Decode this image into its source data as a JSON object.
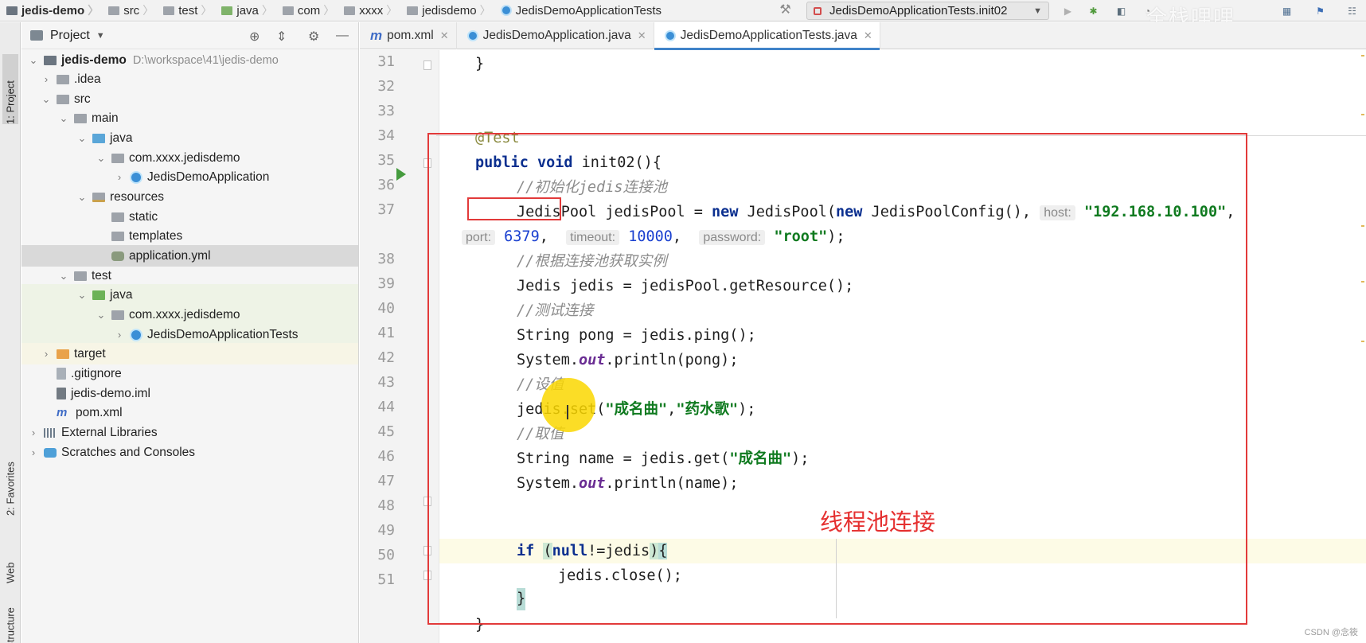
{
  "breadcrumbs": [
    {
      "label": "jedis-demo",
      "icon": "module-icon"
    },
    {
      "label": "src",
      "icon": "folder-icon"
    },
    {
      "label": "test",
      "icon": "folder-icon"
    },
    {
      "label": "java",
      "icon": "test-folder-icon"
    },
    {
      "label": "com",
      "icon": "folder-icon"
    },
    {
      "label": "xxxx",
      "icon": "folder-icon"
    },
    {
      "label": "jedisdemo",
      "icon": "folder-icon"
    },
    {
      "label": "JedisDemoApplicationTests",
      "icon": "class-icon"
    }
  ],
  "toolbar": {
    "run_config": "JedisDemoApplicationTests.init02",
    "watermark": "全栈哩哩"
  },
  "left_strip": {
    "project_tab": "1: Project",
    "favorites_tab": "2: Favorites",
    "web_tab": "Web",
    "structure_tab": "Z: Structure"
  },
  "project_panel": {
    "title": "Project",
    "tree": [
      {
        "label": "jedis-demo",
        "path": "D:\\workspace\\41\\jedis-demo"
      },
      {
        "label": ".idea"
      },
      {
        "label": "src"
      },
      {
        "label": "main"
      },
      {
        "label": "java"
      },
      {
        "label": "com.xxxx.jedisdemo"
      },
      {
        "label": "JedisDemoApplication"
      },
      {
        "label": "resources"
      },
      {
        "label": "static"
      },
      {
        "label": "templates"
      },
      {
        "label": "application.yml"
      },
      {
        "label": "test"
      },
      {
        "label": "java"
      },
      {
        "label": "com.xxxx.jedisdemo"
      },
      {
        "label": "JedisDemoApplicationTests"
      },
      {
        "label": "target"
      },
      {
        "label": ".gitignore"
      },
      {
        "label": "jedis-demo.iml"
      },
      {
        "label": "pom.xml"
      },
      {
        "label": "External Libraries"
      },
      {
        "label": "Scratches and Consoles"
      }
    ]
  },
  "editor_tabs": [
    {
      "label": "pom.xml",
      "icon": "m"
    },
    {
      "label": "JedisDemoApplication.java",
      "icon": "class"
    },
    {
      "label": "JedisDemoApplicationTests.java",
      "icon": "class"
    }
  ],
  "editor": {
    "line_numbers": [
      "31",
      "32",
      "33",
      "34",
      "35",
      "36",
      "37",
      "",
      "38",
      "39",
      "40",
      "41",
      "42",
      "43",
      "44",
      "45",
      "46",
      "47",
      "48",
      "49",
      "50",
      "51"
    ],
    "code": {
      "l31": "}",
      "l34": "@Test",
      "l35_kw1": "public",
      "l35_kw2": "void",
      "l35_rest": " init02(){",
      "l36": "//初始化jedis连接池",
      "l37_type": "JedisPool",
      "l37_a": " jedisPool = ",
      "l37_new1": "new",
      "l37_b": " JedisPool(",
      "l37_new2": "new",
      "l37_c": " JedisPoolConfig(), ",
      "l37_hint_host": "host:",
      "l37_host": "\"192.168.10.100\"",
      "l37_comma": ",",
      "l37w_hint_port": "port:",
      "l37w_port": "6379",
      "l37w_sep1": ", ",
      "l37w_hint_timeout": "timeout:",
      "l37w_timeout": "10000",
      "l37w_sep2": ", ",
      "l37w_hint_password": "password:",
      "l37w_password": "\"root\"",
      "l37w_end": ");",
      "l38": "//根据连接池获取实例",
      "l39": "Jedis jedis = jedisPool.getResource();",
      "l40": "//测试连接",
      "l41": "String pong = jedis.ping();",
      "l42_a": "System.",
      "l42_out": "out",
      "l42_b": ".println(pong);",
      "l43": "//设值",
      "l44_a": "jedis.set(",
      "l44_s1": "\"成名曲\"",
      "l44_b": ",",
      "l44_s2": "\"药水歌\"",
      "l44_c": ");",
      "l45": "//取值",
      "l46_a": "String name = jedis.get(",
      "l46_s": "\"成名曲\"",
      "l46_b": ");",
      "l47_a": "System.",
      "l47_out": "out",
      "l47_b": ".println(name);",
      "l48_if": "if",
      "l48_sp": " ",
      "l48_open": "(",
      "l48_null": "null",
      "l48_mid": "!=jedis",
      "l48_close": ")",
      "l48_brace": "{",
      "l49": "jedis.close();",
      "l50": "}",
      "l51": "}"
    },
    "annotation": "线程池连接",
    "csdn_mark": "CSDN @念筱"
  }
}
